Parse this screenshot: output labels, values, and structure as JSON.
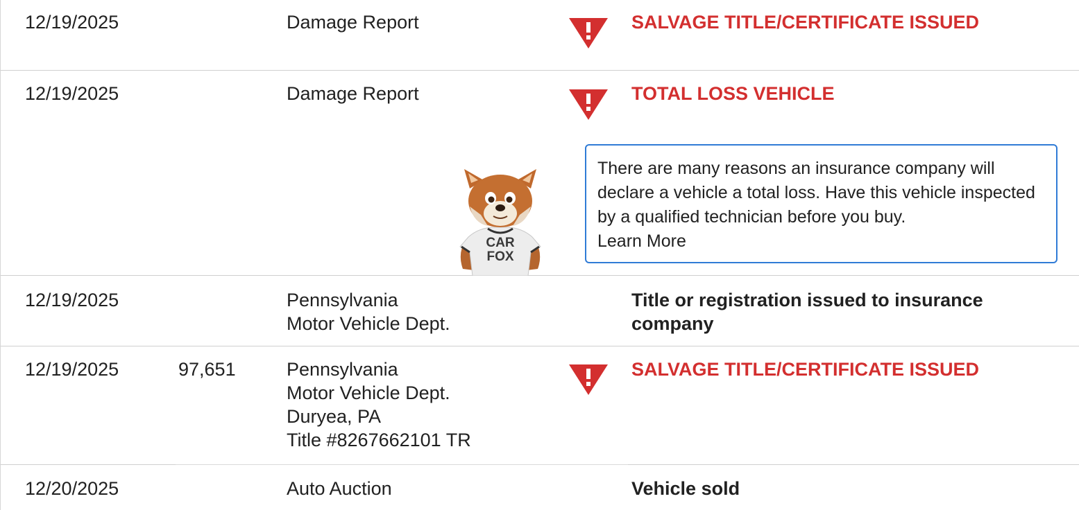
{
  "rows": [
    {
      "date": "12/19/2025",
      "odometer": "",
      "source": [
        "Damage Report"
      ],
      "comment": "SALVAGE TITLE/CERTIFICATE ISSUED",
      "alert": true
    },
    {
      "date": "12/19/2025",
      "odometer": "",
      "source": [
        "Damage Report"
      ],
      "comment": "TOTAL LOSS VEHICLE",
      "alert": true,
      "tip": "There are many reasons an insurance company will declare a vehicle a total loss. Have this vehicle inspected by a qualified technician before you buy.",
      "tip_link": "Learn More",
      "mascot_shirt": [
        "CAR",
        "FOX"
      ]
    },
    {
      "date": "12/19/2025",
      "odometer": "",
      "source": [
        "Pennsylvania",
        "Motor Vehicle Dept."
      ],
      "comment": "Title or registration issued to insurance company",
      "alert": false
    },
    {
      "date": "12/19/2025",
      "odometer": "97,651",
      "source": [
        "Pennsylvania",
        "Motor Vehicle Dept.",
        "Duryea, PA",
        "Title #8267662101 TR"
      ],
      "comment": "SALVAGE TITLE/CERTIFICATE ISSUED",
      "alert": true
    },
    {
      "date": "12/20/2025",
      "odometer": "",
      "source": [
        "Auto Auction"
      ],
      "comment": "Vehicle sold",
      "alert": false
    }
  ],
  "icons": {
    "alert": "alert-triangle-icon",
    "mascot": "car-fox-mascot-icon"
  },
  "colors": {
    "alert": "#d32f2f",
    "tip_border": "#2f7bd6",
    "text": "#212121",
    "divider": "#cfcfcf"
  }
}
